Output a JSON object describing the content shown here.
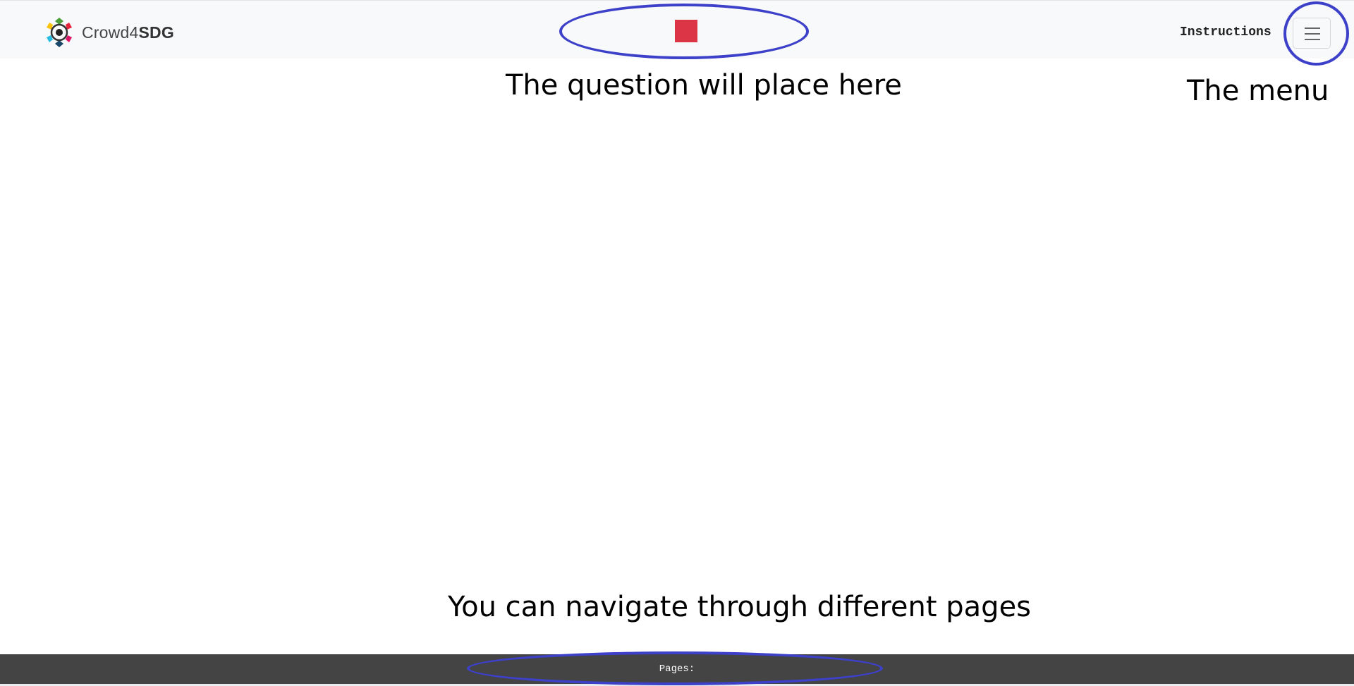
{
  "navbar": {
    "brand_regular": "Crowd4",
    "brand_bold": "SDG",
    "instructions_label": "Instructions",
    "menu_icon": "hamburger-icon",
    "question_marker_color": "#dc3545",
    "logo_icon": "crowd4sdg-logo-icon"
  },
  "annotations": {
    "question": "The question will place here",
    "menu": "The menu",
    "navigation": "You can navigate through different pages",
    "highlight_color": "#3d40c8"
  },
  "footer": {
    "pages_label": "Pages:",
    "background": "#444444"
  }
}
